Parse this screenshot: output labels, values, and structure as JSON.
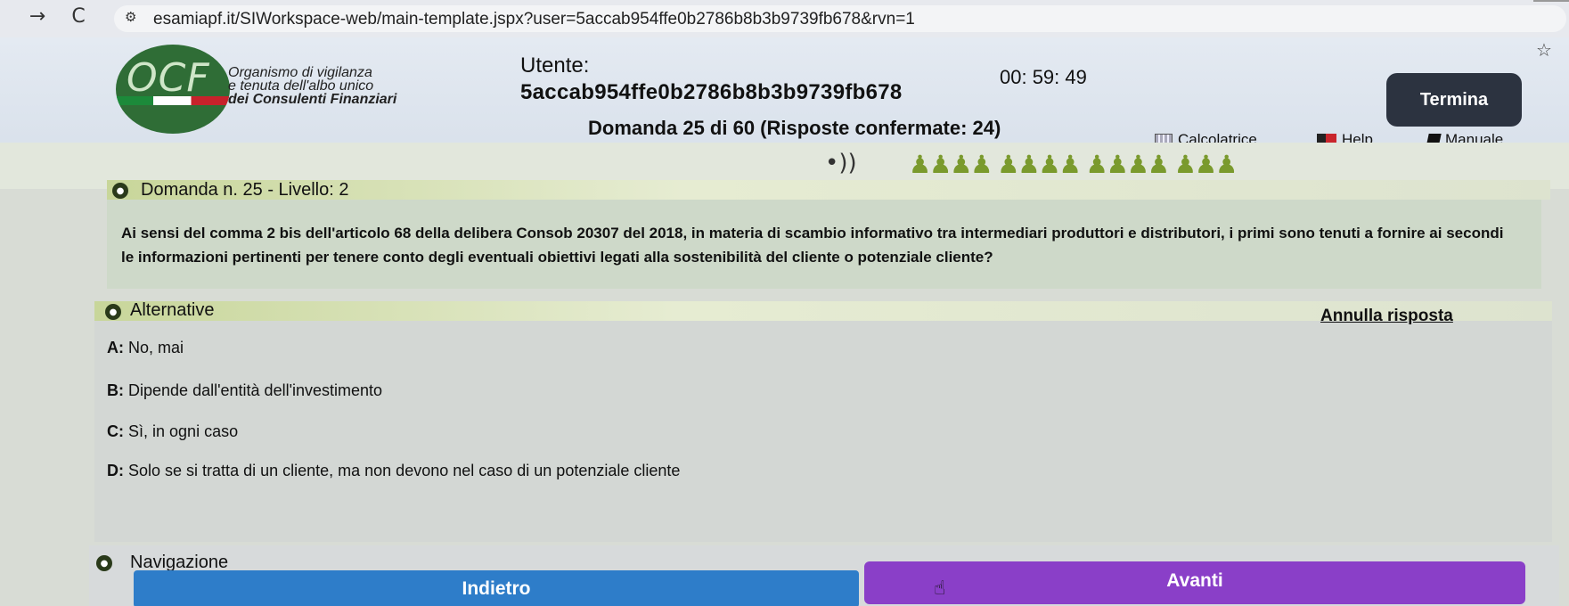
{
  "browser": {
    "back_icon": "→",
    "reload_icon": "C",
    "site_info_icon": "⚙",
    "url": "esamiapf.it/SIWorkspace-web/main-template.jspx?user=5accab954ffe0b2786b8b3b9739fb678&rvn=1",
    "bookmark_icon": "☆"
  },
  "header": {
    "logo_text": "OCF",
    "org_line1": "Organismo di vigilanza",
    "org_line2": "e tenuta dell'albo unico",
    "org_line3": "dei Consulenti Finanziari",
    "user_label": "Utente:",
    "user_value": "5accab954ffe0b2786b8b3b9739fb678",
    "timer": "00: 59: 49",
    "termina_label": "Termina",
    "question_counter": "Domanda 25 di 60 (Risposte confermate: 24)",
    "calculator_label": "Calcolatrice",
    "help_label": "Help",
    "manual_label": "Manuale"
  },
  "question": {
    "section_title": "Domanda n. 25 - Livello: 2",
    "text": "Ai sensi del comma 2 bis dell'articolo 68 della delibera Consob 20307 del 2018, in materia di scambio informativo tra intermediari produttori e distributori, i primi sono tenuti a fornire ai secondi le informazioni pertinenti per tenere conto degli eventuali obiettivi legati alla sostenibilità del cliente o potenziale cliente?"
  },
  "alternatives": {
    "section_title": "Alternative",
    "cancel_label": "Annulla risposta",
    "items": [
      {
        "letter": "A:",
        "text": "No, mai"
      },
      {
        "letter": "B:",
        "text": "Dipende dall'entità dell'investimento"
      },
      {
        "letter": "C:",
        "text": "Sì, in ogni caso"
      },
      {
        "letter": "D:",
        "text": "Solo se si tratta di un cliente, ma non devono nel caso di un potenziale cliente"
      }
    ]
  },
  "navigation": {
    "section_title": "Navigazione",
    "back_label": "Indietro",
    "next_label": "Avanti"
  },
  "colors": {
    "termina_bg": "#2c3340",
    "back_button": "#2e7dc9",
    "next_button": "#8a3fc8",
    "section_accent": "#c8d69a",
    "logo_green": "#2f6d36"
  }
}
